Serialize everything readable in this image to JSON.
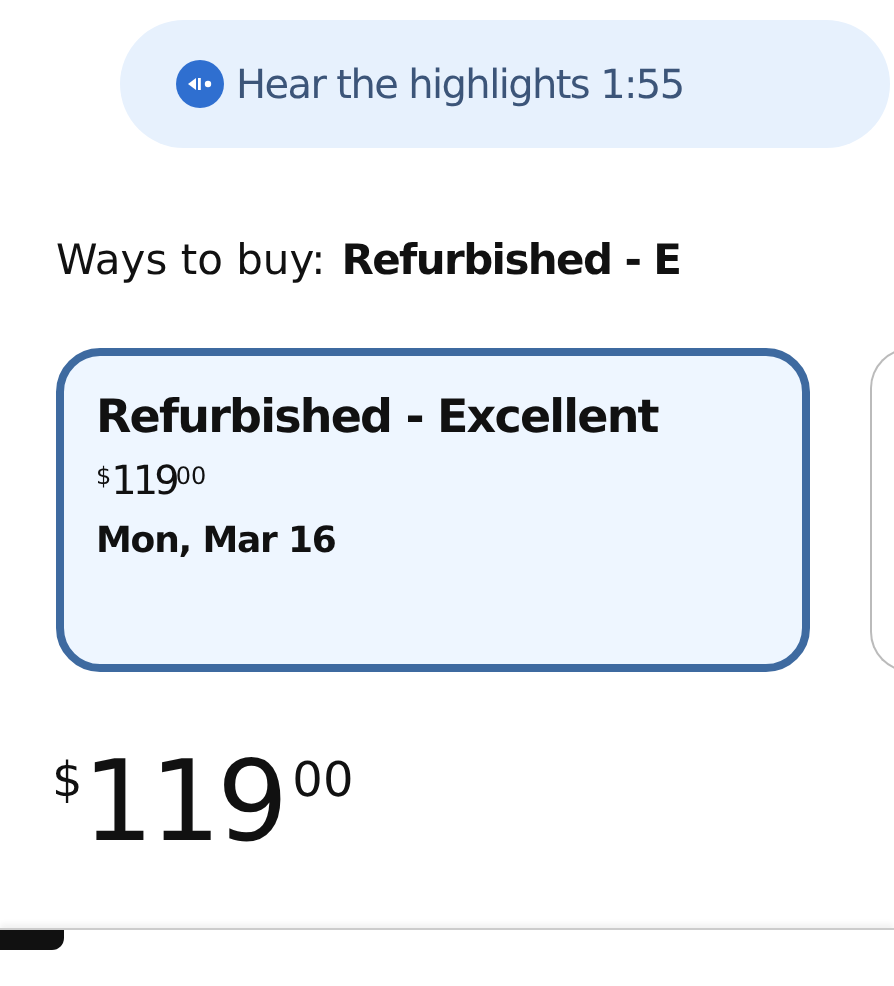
{
  "audio_pill": {
    "label": "Hear the highlights",
    "duration": "1:55"
  },
  "ways_to_buy": {
    "label": "Ways to buy:",
    "value": "Refurbished - E"
  },
  "options": [
    {
      "selected": true,
      "title": "Refurbished - Excellent",
      "price": {
        "currency": "$",
        "dollars": "119",
        "cents": "00"
      },
      "date": "Mon, Mar 16"
    },
    {
      "selected": false
    }
  ],
  "price": {
    "currency": "$",
    "dollars": "119",
    "cents": "00"
  }
}
